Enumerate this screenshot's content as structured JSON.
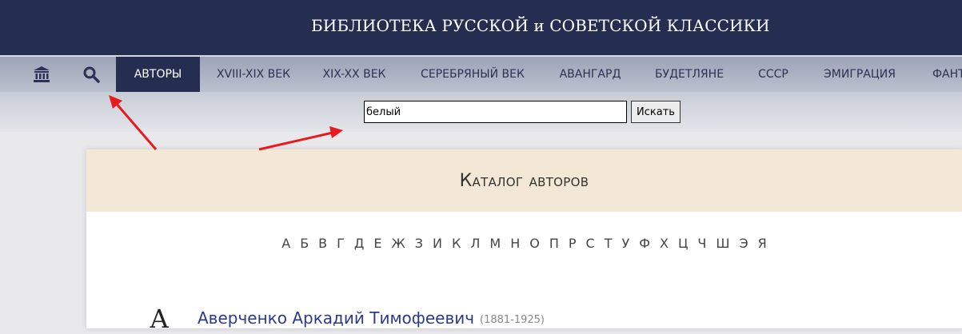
{
  "header": {
    "title": "БИБЛИОТЕКА РУССКОЙ и СОВЕТСКОЙ КЛАССИКИ"
  },
  "nav": {
    "home_icon": "library-building-icon",
    "search_icon": "search-icon",
    "items": [
      {
        "label": "АВТОРЫ",
        "active": true
      },
      {
        "label": "XVIII-XIX ВЕК"
      },
      {
        "label": "XIX-XX ВЕК"
      },
      {
        "label": "СЕРЕБРЯНЫЙ ВЕК"
      },
      {
        "label": "АВАНГАРД"
      },
      {
        "label": "БУДЕТЛЯНЕ"
      },
      {
        "label": "СССР"
      },
      {
        "label": "ЭМИГРАЦИЯ"
      },
      {
        "label": "ФАНТ"
      }
    ]
  },
  "search": {
    "value": "белый",
    "button_label": "Искать"
  },
  "catalog": {
    "title": "Каталог авторов",
    "letters": [
      "А",
      "Б",
      "В",
      "Г",
      "Д",
      "Е",
      "Ж",
      "З",
      "И",
      "К",
      "Л",
      "М",
      "Н",
      "О",
      "П",
      "Р",
      "С",
      "Т",
      "У",
      "Ф",
      "Х",
      "Ц",
      "Ч",
      "Ш",
      "Э",
      "Я"
    ],
    "sections": [
      {
        "letter": "А",
        "authors": [
          {
            "name": "Аверченко Аркадий Тимофеевич",
            "years": "(1881-1925)"
          }
        ]
      }
    ]
  },
  "colors": {
    "header_bg": "#252d50",
    "active_nav_bg": "#252d50",
    "catalog_header_bg": "#f3e8d6",
    "link_color": "#2b3a8a",
    "annotation_arrow": "#e8191f"
  }
}
